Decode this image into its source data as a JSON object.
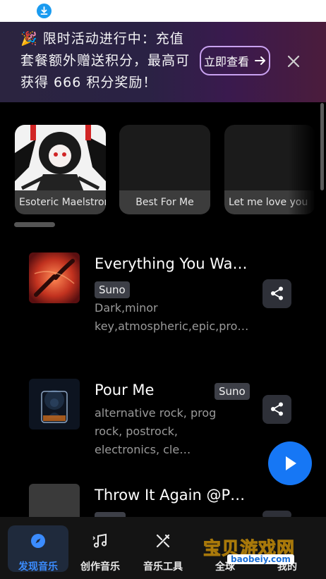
{
  "promo": {
    "text": "🎉 限时活动进行中：充值套餐额外赠送积分，最高可获得 666 积分奖励！",
    "button_label": "立即查看"
  },
  "carousel": [
    {
      "title": "Esoteric Maelstrom"
    },
    {
      "title": "Best For Me"
    },
    {
      "title": "Let me love you"
    }
  ],
  "songs": [
    {
      "title": "Everything You Wa…",
      "tag": "Suno",
      "desc": "Dark,minor key,atmospheric,epic,pro…"
    },
    {
      "title": "Pour Me",
      "tag": "Suno",
      "desc": "alternative rock, prog rock, postrock, electronics, cle…"
    },
    {
      "title": "Throw It Again @P…"
    }
  ],
  "nav": [
    {
      "label": "发现音乐",
      "icon": "compass-icon"
    },
    {
      "label": "创作音乐",
      "icon": "music-note-icon"
    },
    {
      "label": "音乐工具",
      "icon": "tools-icon"
    },
    {
      "label": "全球",
      "icon": "globe-icon"
    },
    {
      "label": "我的",
      "icon": "user-icon"
    }
  ],
  "watermark": {
    "text": "宝贝游戏网",
    "url": "baobeiy.com"
  },
  "colors": {
    "accent": "#1677f5",
    "tag_bg": "#3d3f47",
    "promo_border": "#c9a2f0"
  }
}
